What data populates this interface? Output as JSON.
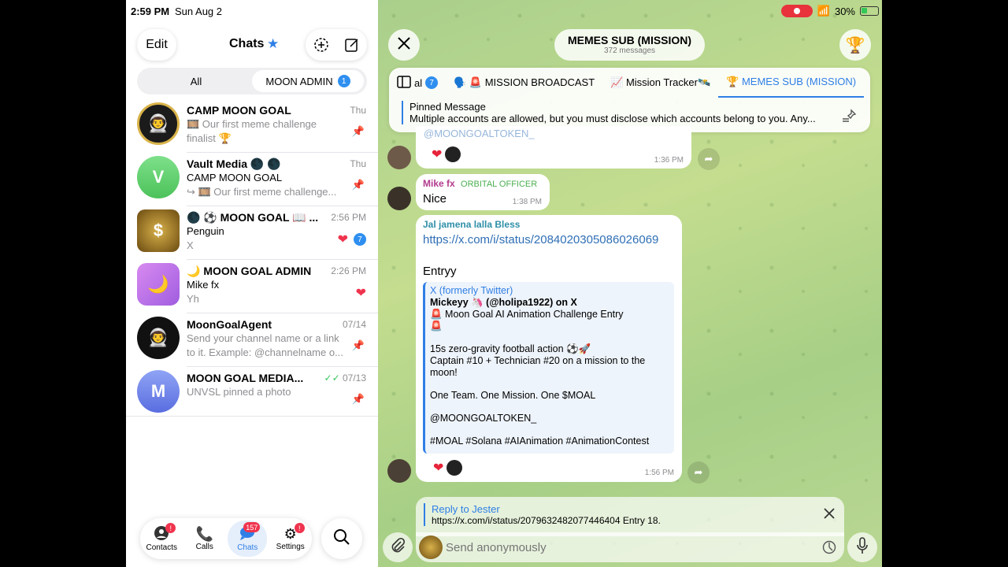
{
  "status_bar": {
    "time": "2:59 PM",
    "date": "Sun Aug 2",
    "battery": "30%"
  },
  "left": {
    "edit": "Edit",
    "title": "Chats",
    "filters": {
      "all": "All",
      "moon_admin": "MOON ADMIN",
      "moon_admin_badge": "1"
    },
    "chats": [
      {
        "name": "CAMP MOON GOAL",
        "line2": "🎞️ Our first meme challenge",
        "line3": "finalist 🏆",
        "time": "Thu",
        "pinned": true
      },
      {
        "name": "Vault Media 🌑 🌑",
        "line2": "CAMP MOON GOAL",
        "line3": "↪ 🎞️ Our first meme challenge...",
        "time": "Thu",
        "pinned": true,
        "avatar_letter": "V"
      },
      {
        "name": "🌑 ⚽ MOON GOAL 📖 ...",
        "line2": "Penguin",
        "line3": "X",
        "time": "2:56 PM",
        "unread": "7"
      },
      {
        "name": "🌙 MOON GOAL ADMIN",
        "line2": "Mike fx",
        "line3": "Yh",
        "time": "2:26 PM"
      },
      {
        "name": "MoonGoalAgent",
        "line2": "Send your channel name or a link",
        "line3": "to it. Example: @channelname o...",
        "time": "07/14",
        "pinned": true
      },
      {
        "name": "MOON GOAL MEDIA...",
        "line2": "UNVSL pinned a photo",
        "line3": "",
        "time": "07/13",
        "pinned": true,
        "avatar_letter": "M"
      }
    ],
    "tabs": {
      "contacts": "Contacts",
      "calls": "Calls",
      "chats": "Chats",
      "settings": "Settings",
      "chats_badge": "157",
      "contacts_badge": "!",
      "settings_badge": "!"
    }
  },
  "right": {
    "title": "MEMES SUB (MISSION)",
    "subtitle": "372 messages",
    "topics": [
      "al",
      "🗣️ 🚨 MISSION BROADCAST",
      "📈 Mission Tracker🛰️",
      "🏆 MEMES SUB (MISSION)"
    ],
    "topics_badge": "7",
    "pinned": {
      "title": "Pinned Message",
      "text": "Multiple accounts are allowed, but you must disclose which accounts belong to you. Any..."
    },
    "msg1": {
      "partial": "@MOONGOALTOKEN_",
      "time": "1:36 PM"
    },
    "msg2": {
      "author": "Mike fx",
      "role": "ORBITAL OFFICER",
      "text": "Nice",
      "time": "1:38 PM"
    },
    "msg3": {
      "author": "Jal jamena lalla Bless",
      "link": "https://x.com/i/status/2084020305086026069",
      "text": "Entryy",
      "time": "1:56 PM",
      "preview": {
        "source": "X (formerly Twitter)",
        "title": "Mickeyy 🦄 (@holipa1922) on X",
        "l1": "🚨 Moon Goal AI Animation Challenge Entry",
        "l1b": "🚨",
        "l2": "15s zero-gravity football action ⚽🚀",
        "l3": "Captain #10 + Technician #20 on a mission to the",
        "l4": "moon!",
        "l5": "One Team. One Mission. One $MOAL",
        "l6": "@MOONGOALTOKEN_",
        "l7": "#MOAL #Solana #AIAnimation #AnimationContest"
      }
    },
    "reply": {
      "title": "Reply to Jester",
      "text": "https://x.com/i/status/2079632482077446404 Entry 18."
    },
    "input_placeholder": "Send anonymously"
  }
}
